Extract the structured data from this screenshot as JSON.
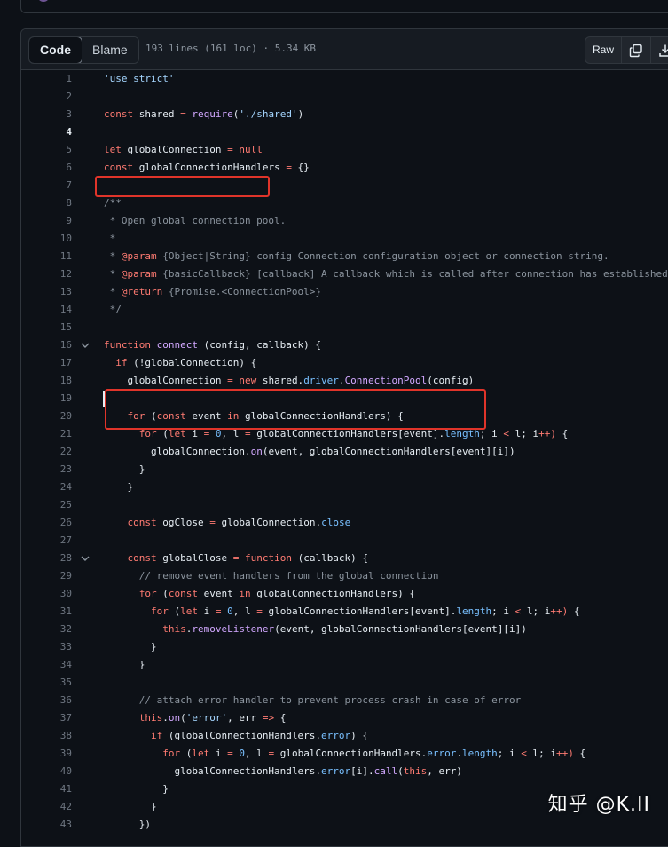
{
  "toolbar": {
    "code_label": "Code",
    "blame_label": "Blame",
    "file_info": "193 lines (161 loc) · 5.34 KB",
    "raw_label": "Raw"
  },
  "lines": [
    "'use strict'",
    "",
    "const shared = require('./shared')",
    "",
    "let globalConnection = null",
    "const globalConnectionHandlers = {}",
    "",
    "/**",
    " * Open global connection pool.",
    " *",
    " * @param {Object|String} config Connection configuration object or connection string.",
    " * @param {basicCallback} [callback] A callback which is called after connection has established,",
    " * @return {Promise.<ConnectionPool>}",
    " */",
    "",
    "function connect (config, callback) {",
    "  if (!globalConnection) {",
    "    globalConnection = new shared.driver.ConnectionPool(config)",
    "",
    "    for (const event in globalConnectionHandlers) {",
    "      for (let i = 0, l = globalConnectionHandlers[event].length; i < l; i++) {",
    "        globalConnection.on(event, globalConnectionHandlers[event][i])",
    "      }",
    "    }",
    "",
    "    const ogClose = globalConnection.close",
    "",
    "    const globalClose = function (callback) {",
    "      // remove event handlers from the global connection",
    "      for (const event in globalConnectionHandlers) {",
    "        for (let i = 0, l = globalConnectionHandlers[event].length; i < l; i++) {",
    "          this.removeListener(event, globalConnectionHandlers[event][i])",
    "        }",
    "      }",
    "",
    "      // attach error handler to prevent process crash in case of error",
    "      this.on('error', err => {",
    "        if (globalConnectionHandlers.error) {",
    "          for (let i = 0, l = globalConnectionHandlers.error.length; i < l; i++) {",
    "            globalConnectionHandlers.error[i].call(this, err)",
    "          }",
    "        }",
    "      })"
  ],
  "watermark": "知乎 @K.II",
  "colors": {
    "background": "#0d1117",
    "header": "#161b22",
    "highlight_box": "#e0342a",
    "keyword": "#ff7b72",
    "string": "#a5d6ff",
    "function": "#d2a8ff",
    "property": "#79c0ff",
    "comment": "#8b949e"
  }
}
